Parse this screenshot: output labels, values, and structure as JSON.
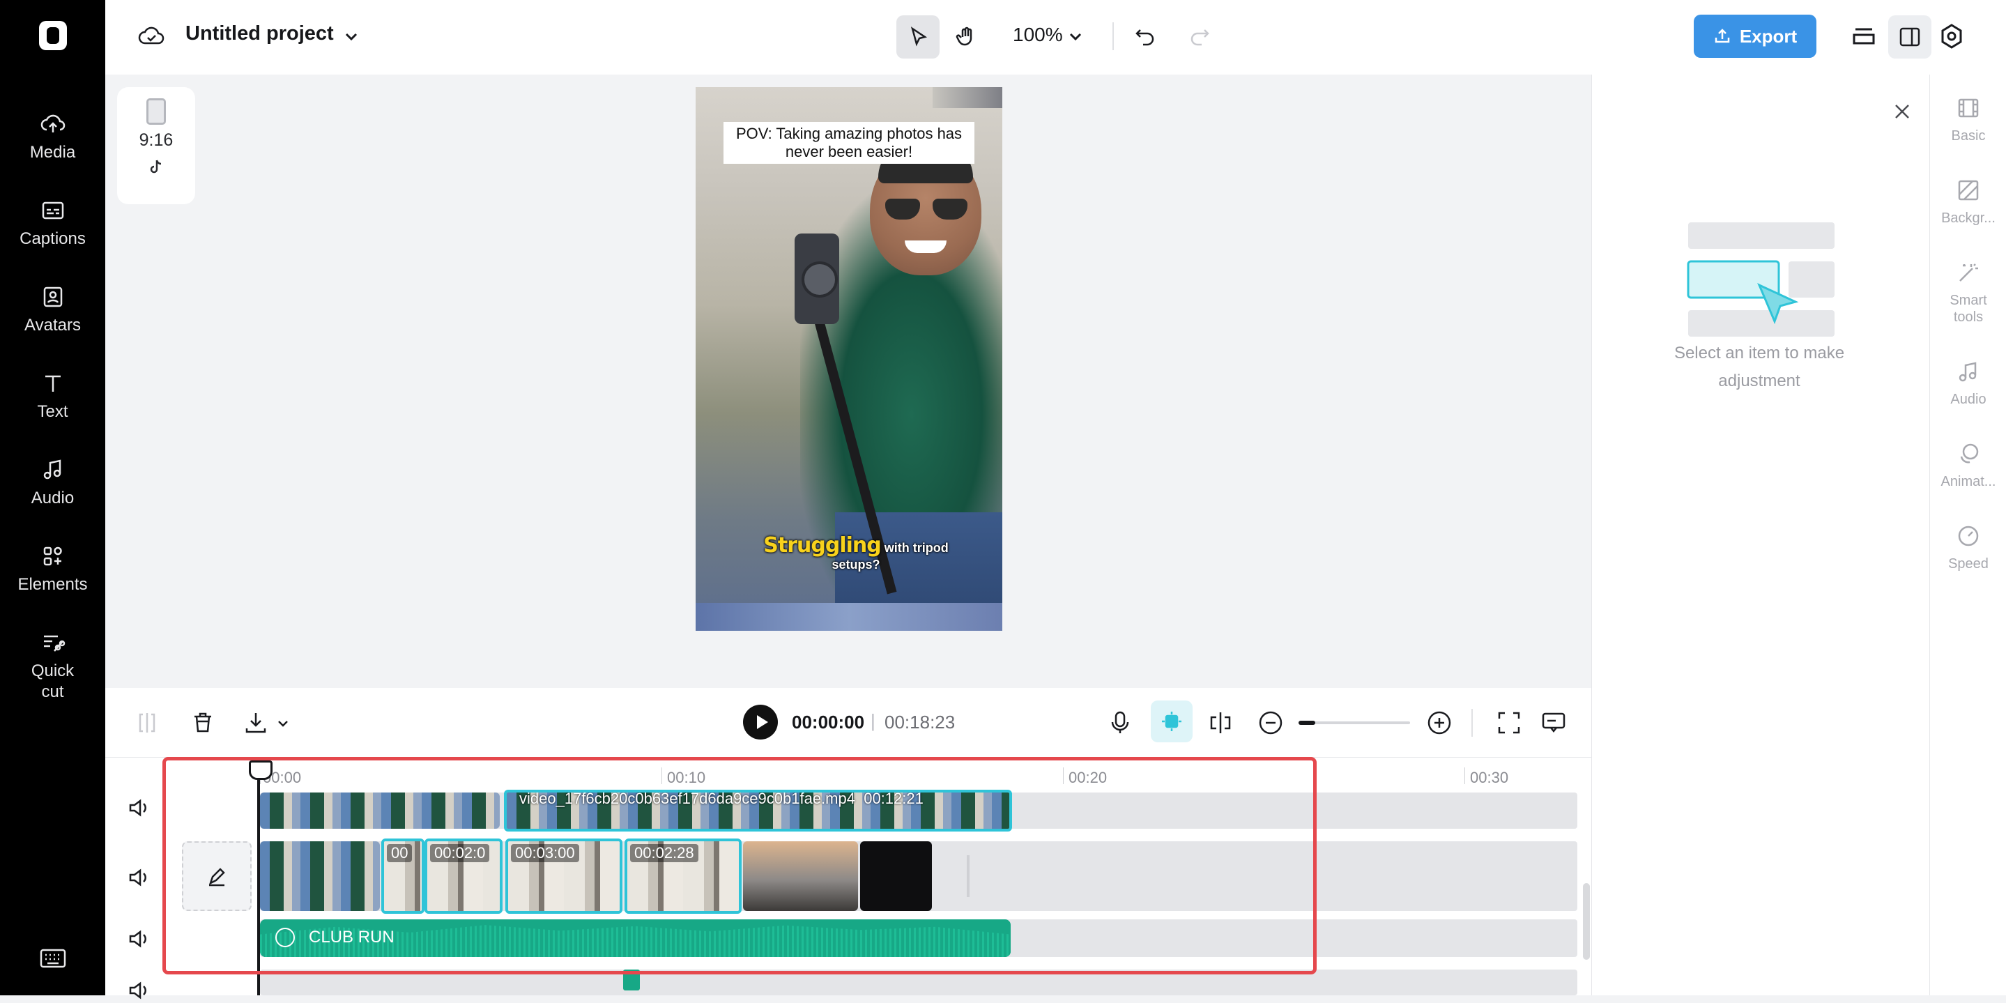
{
  "left_rail": {
    "items": [
      {
        "label": "Media",
        "icon": "cloud-upload-icon"
      },
      {
        "label": "Captions",
        "icon": "captions-icon"
      },
      {
        "label": "Avatars",
        "icon": "avatar-icon"
      },
      {
        "label": "Text",
        "icon": "text-icon"
      },
      {
        "label": "Audio",
        "icon": "music-note-icon"
      },
      {
        "label": "Elements",
        "icon": "elements-icon"
      },
      {
        "label": "Quick cut",
        "icon": "quick-cut-icon"
      }
    ]
  },
  "header": {
    "project_title": "Untitled project",
    "zoom": "100%",
    "export_label": "Export"
  },
  "canvas": {
    "aspect_ratio": "9:16",
    "caption_top": "POV: Taking amazing photos has never been easier!",
    "caption_bottom_highlight": "Struggling",
    "caption_bottom_rest": "with tripod setups?"
  },
  "right_panel": {
    "empty_text": "Select an item to make adjustment"
  },
  "right_rail": {
    "items": [
      {
        "label": "Basic",
        "icon": "film-icon"
      },
      {
        "label": "Backgr...",
        "icon": "background-icon"
      },
      {
        "label": "Smart tools",
        "icon": "magic-wand-icon"
      },
      {
        "label": "Audio",
        "icon": "music-note-icon"
      },
      {
        "label": "Animat...",
        "icon": "animation-icon"
      },
      {
        "label": "Speed",
        "icon": "speedometer-icon"
      }
    ]
  },
  "player": {
    "current_time": "00:00:00",
    "separator": "|",
    "total_time": "00:18:23"
  },
  "timeline": {
    "ruler": [
      "00:00",
      "00:10",
      "00:20",
      "00:30"
    ],
    "video_track_title": "video_17f6cb20c0b63ef17d6da9ce9c0b1fae.mp4",
    "video_track_duration": "00:12:21",
    "clips": [
      {
        "time": "00"
      },
      {
        "time": "00:02:0"
      },
      {
        "time": "00:03:00"
      },
      {
        "time": "00:02:28"
      }
    ],
    "audio_label": "CLUB RUN"
  },
  "colors": {
    "accent": "#3a93e6",
    "selection": "#2fc4d8",
    "audio": "#17a886",
    "highlight": "#e5484d"
  }
}
